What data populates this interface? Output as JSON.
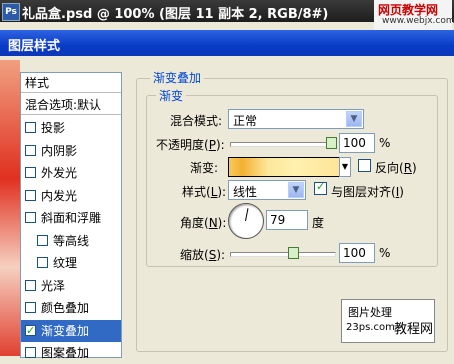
{
  "ps_window": {
    "title": "礼品盒.psd @ 100% (图层 11 副本 2, RGB/8#)",
    "app_icon": "Ps"
  },
  "watermark": {
    "line1": "网页教学网",
    "line2": "www.webjx.com"
  },
  "dialog": {
    "title": "图层样式"
  },
  "style_list": {
    "header": "样式",
    "blend": "混合选项:默认",
    "items": [
      {
        "label": "投影",
        "checked": false,
        "selected": false,
        "indent": false
      },
      {
        "label": "内阴影",
        "checked": false,
        "selected": false,
        "indent": false
      },
      {
        "label": "外发光",
        "checked": false,
        "selected": false,
        "indent": false
      },
      {
        "label": "内发光",
        "checked": false,
        "selected": false,
        "indent": false
      },
      {
        "label": "斜面和浮雕",
        "checked": false,
        "selected": false,
        "indent": false
      },
      {
        "label": "等高线",
        "checked": false,
        "selected": false,
        "indent": true
      },
      {
        "label": "纹理",
        "checked": false,
        "selected": false,
        "indent": true
      },
      {
        "label": "光泽",
        "checked": false,
        "selected": false,
        "indent": false
      },
      {
        "label": "颜色叠加",
        "checked": false,
        "selected": false,
        "indent": false
      },
      {
        "label": "渐变叠加",
        "checked": true,
        "selected": true,
        "indent": false
      },
      {
        "label": "图案叠加",
        "checked": false,
        "selected": false,
        "indent": false
      }
    ]
  },
  "panel": {
    "section_title": "渐变叠加",
    "group_title": "渐变",
    "blend_mode": {
      "label": "混合模式:",
      "value": "正常"
    },
    "opacity": {
      "label_pre": "不透明度(",
      "key": "P",
      "label_post": "):",
      "value": "100",
      "unit": "%",
      "level": 1.0
    },
    "gradient": {
      "label": "渐变:",
      "reverse_pre": "反向(",
      "reverse_key": "R",
      "reverse_post": ")",
      "reverse_checked": false
    },
    "style": {
      "label_pre": "样式(",
      "key": "L",
      "label_post": "):",
      "value": "线性",
      "align_pre": "与图层对齐(",
      "align_key": "I",
      "align_post": ")",
      "align_checked": true
    },
    "angle": {
      "label_pre": "角度(",
      "key": "N",
      "label_post": "):",
      "value": "79",
      "unit": "度"
    },
    "scale": {
      "label_pre": "缩放(",
      "key": "S",
      "label_post": "):",
      "value": "100",
      "unit": "%",
      "level": 0.5
    }
  },
  "logo": {
    "line1": "图片处理",
    "line2": "23ps.com",
    "line3": "教程网"
  }
}
